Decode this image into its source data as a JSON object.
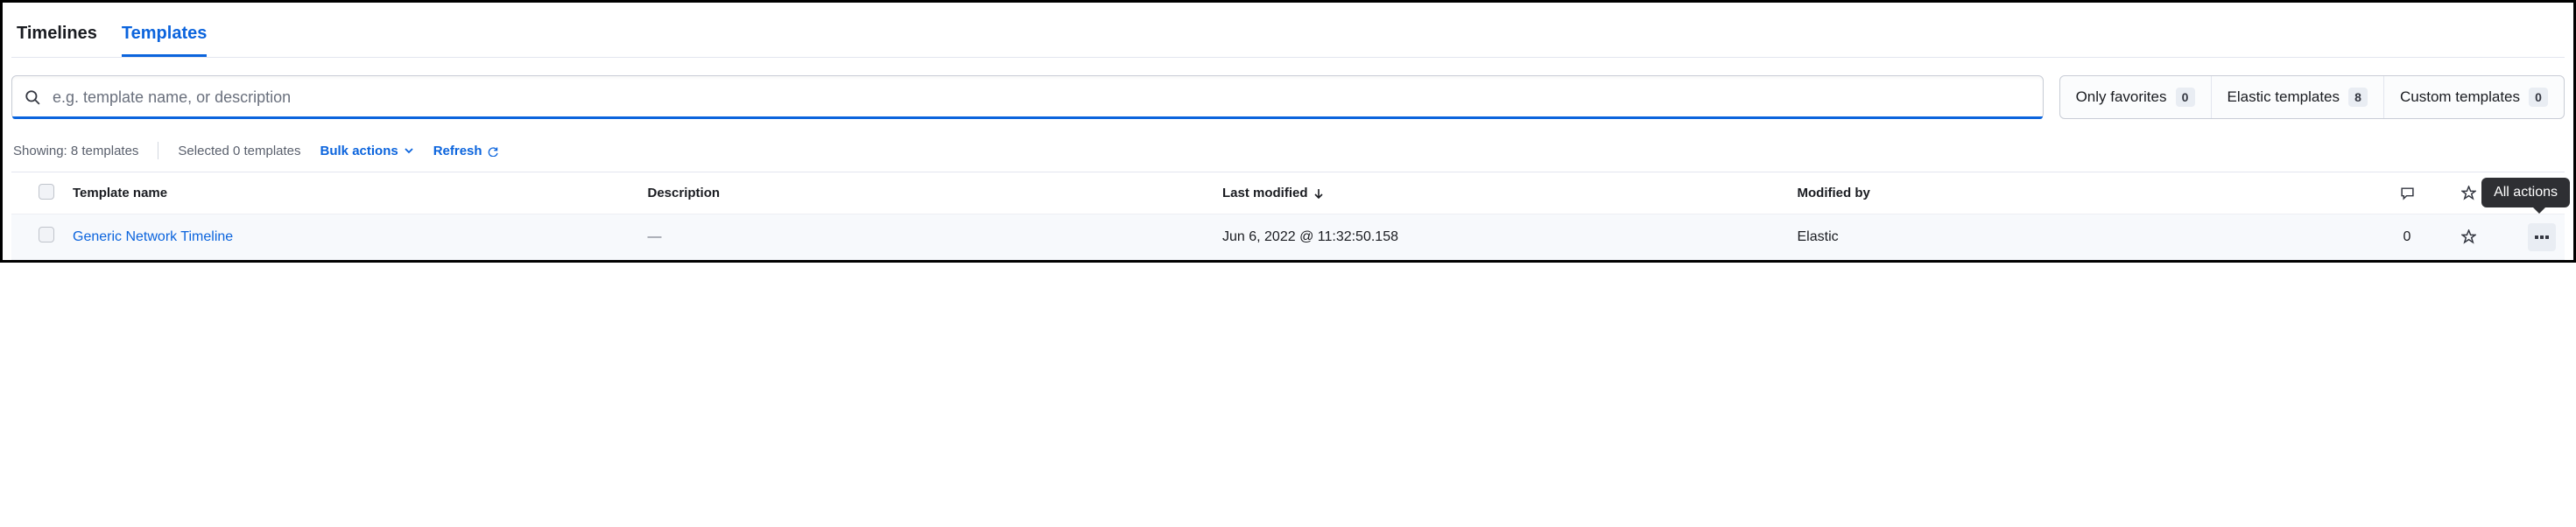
{
  "tabs": [
    {
      "label": "Timelines",
      "active": false
    },
    {
      "label": "Templates",
      "active": true
    }
  ],
  "search": {
    "placeholder": "e.g. template name, or description",
    "value": ""
  },
  "filters": {
    "only_favorites": {
      "label": "Only favorites",
      "count": "0"
    },
    "elastic_templates": {
      "label": "Elastic templates",
      "count": "8"
    },
    "custom_templates": {
      "label": "Custom templates",
      "count": "0"
    }
  },
  "status": {
    "showing": "Showing: 8 templates",
    "selected": "Selected 0 templates",
    "bulk_actions": "Bulk actions",
    "refresh": "Refresh"
  },
  "columns": {
    "template_name": "Template name",
    "description": "Description",
    "last_modified": "Last modified",
    "modified_by": "Modified by"
  },
  "rows": [
    {
      "name": "Generic Network Timeline",
      "description": "—",
      "last_modified": "Jun 6, 2022 @ 11:32:50.158",
      "modified_by": "Elastic",
      "comment_count": "0"
    }
  ],
  "tooltip": "All actions"
}
